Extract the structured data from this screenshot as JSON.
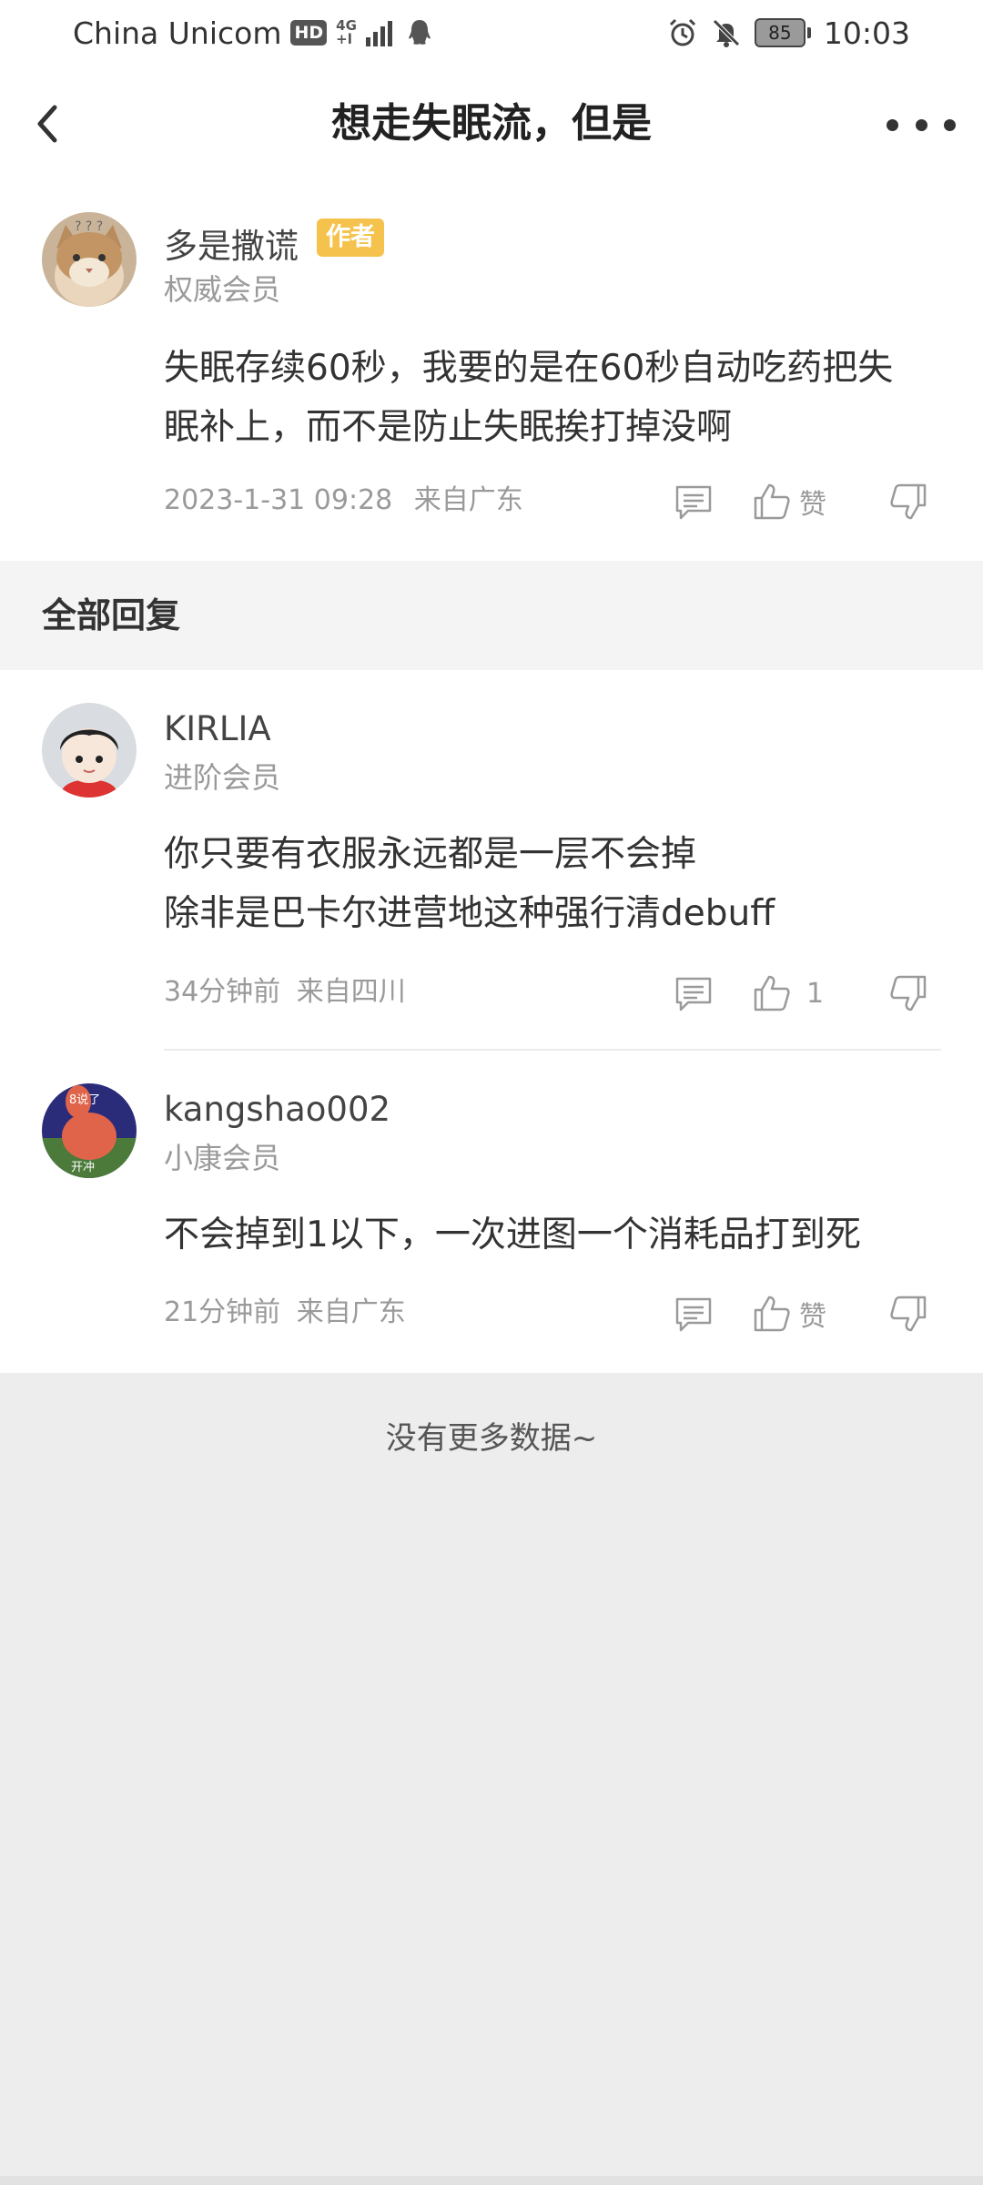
{
  "status_bar": {
    "carrier": "China Unicom",
    "hd_badge": "HD",
    "network_top": "4G",
    "network_bottom": "+l",
    "battery": "85",
    "time": "10:03"
  },
  "header": {
    "title": "想走失眠流，但是"
  },
  "main_post": {
    "user_name": "多是撒谎",
    "author_badge": "作者",
    "user_level": "权威会员",
    "content": "失眠存续60秒，我要的是在60秒自动吃药把失眠补上，而不是防止失眠挨打掉没啊",
    "timestamp": "2023-1-31 09:28",
    "location": "来自广东",
    "like_label": "赞"
  },
  "replies_header": "全部回复",
  "replies": [
    {
      "user_name": "KIRLIA",
      "user_level": "进阶会员",
      "content_line1": "你只要有衣服永远都是一层不会掉",
      "content_line2": "除非是巴卡尔进营地这种强行清debuff",
      "time": "34分钟前",
      "location": "来自四川",
      "like_label": "1"
    },
    {
      "user_name": "kangshao002",
      "user_level": "小康会员",
      "avatar_text_top": "8说了",
      "avatar_text_bottom": "开冲",
      "content": "不会掉到1以下，一次进图一个消耗品打到死",
      "time": "21分钟前",
      "location": "来自广东",
      "like_label": "赞"
    }
  ],
  "footer": {
    "no_more": "没有更多数据~"
  },
  "colors": {
    "badge": "#f5c34d",
    "page_bg": "#ededed",
    "muted_text": "#9a9a9a"
  },
  "icons": [
    "back-arrow-icon",
    "more-dots-icon",
    "comment-icon",
    "thumbs-up-icon",
    "thumbs-down-icon",
    "alarm-icon",
    "bell-off-icon",
    "qq-icon",
    "signal-icon"
  ]
}
